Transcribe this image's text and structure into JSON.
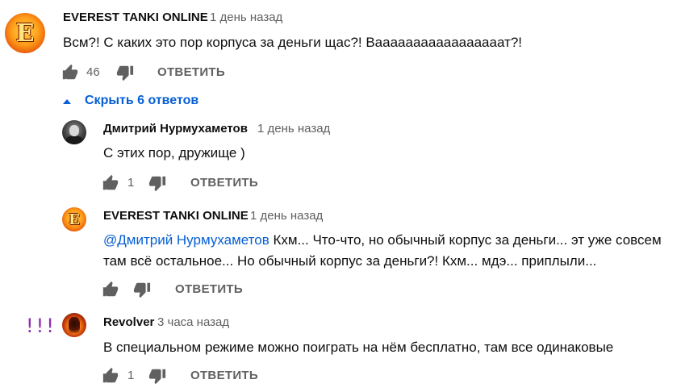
{
  "comment_main": {
    "author": "EVEREST TANKI ONLINE",
    "time": "1 день назад",
    "text": "Всм?! С каких это пор корпуса за деньги щас?! Вааааааааааааааааат?!",
    "likes": "46",
    "reply_label": "ОТВЕТИТЬ",
    "avatar_letter": "E"
  },
  "hide_replies": {
    "label": "Скрыть 6 ответов"
  },
  "replies": [
    {
      "author": "Дмитрий Нурмухаметов",
      "time": "1 день назад",
      "text": "С этих пор, дружище )",
      "likes": "1",
      "reply_label": "ОТВЕТИТЬ"
    },
    {
      "author": "EVEREST TANKI ONLINE",
      "time": "1 день назад",
      "mention": "@Дмитрий Нурмухаметов",
      "text_line1": " Кхм... Что-что, но обычный корпус за деньги... эт уже совсем",
      "text_line2": "там всё остальное... Но обычный корпус за деньги?! Кхм... мдэ... приплыли...",
      "likes": "",
      "reply_label": "ОТВЕТИТЬ",
      "avatar_letter": "E"
    },
    {
      "author": "Revolver",
      "time": "3 часа назад",
      "text": "В специальном режиме можно поиграть на нём бесплатно, там все одинаковые",
      "likes": "1",
      "reply_label": "ОТВЕТИТЬ"
    }
  ],
  "annotation": "!!!",
  "colors": {
    "link": "#065fd4",
    "secondary": "#606060",
    "annotation": "#8e2fb0"
  }
}
